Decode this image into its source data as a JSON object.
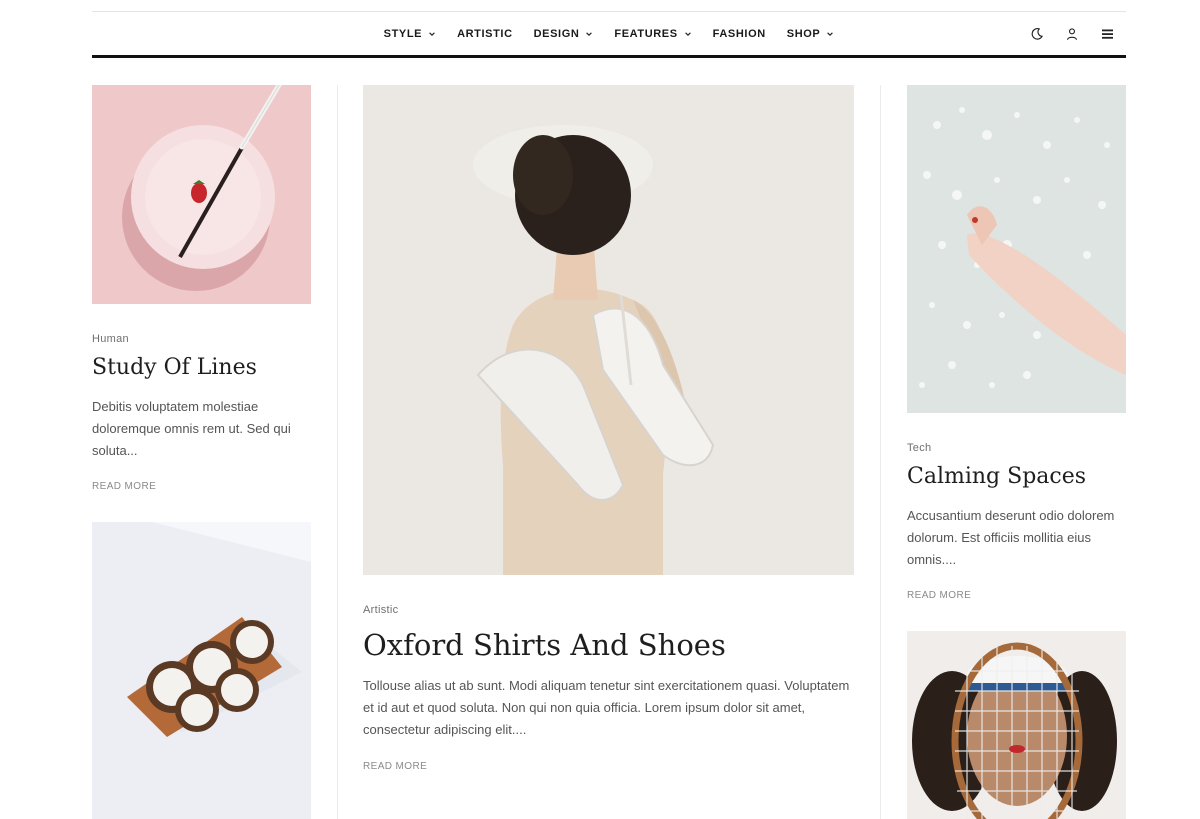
{
  "nav": {
    "items": [
      {
        "label": "STYLE",
        "has_dropdown": true
      },
      {
        "label": "ARTISTIC",
        "has_dropdown": false
      },
      {
        "label": "DESIGN",
        "has_dropdown": true
      },
      {
        "label": "FEATURES",
        "has_dropdown": true
      },
      {
        "label": "FASHION",
        "has_dropdown": false
      },
      {
        "label": "SHOP",
        "has_dropdown": true
      }
    ],
    "icons": [
      "dark-mode-moon-icon",
      "user-account-icon",
      "hamburger-menu-icon"
    ]
  },
  "posts": {
    "left_top": {
      "category": "Human",
      "title": "Study Of Lines",
      "excerpt": "Debitis voluptatem molestiae doloremque omnis rem ut. Sed qui soluta...",
      "read_more": "READ MORE"
    },
    "center": {
      "category": "Artistic",
      "title": "Oxford Shirts And Shoes",
      "excerpt": "Tollouse alias ut ab sunt. Modi aliquam tenetur sint exercitationem quasi. Voluptatem et id aut et quod soluta. Non qui non quia officia. Lorem ipsum dolor sit amet, consectetur adipiscing elit....",
      "read_more": "READ MORE"
    },
    "right_top": {
      "category": "Tech",
      "title": "Calming Spaces",
      "excerpt": "Accusantium deserunt odio dolorem dolorum. Est officiis mollitia eius omnis....",
      "read_more": "READ MORE"
    }
  },
  "colors": {
    "text_dark": "#1e1e1e",
    "text_muted": "#555555",
    "rule": "#111111"
  }
}
